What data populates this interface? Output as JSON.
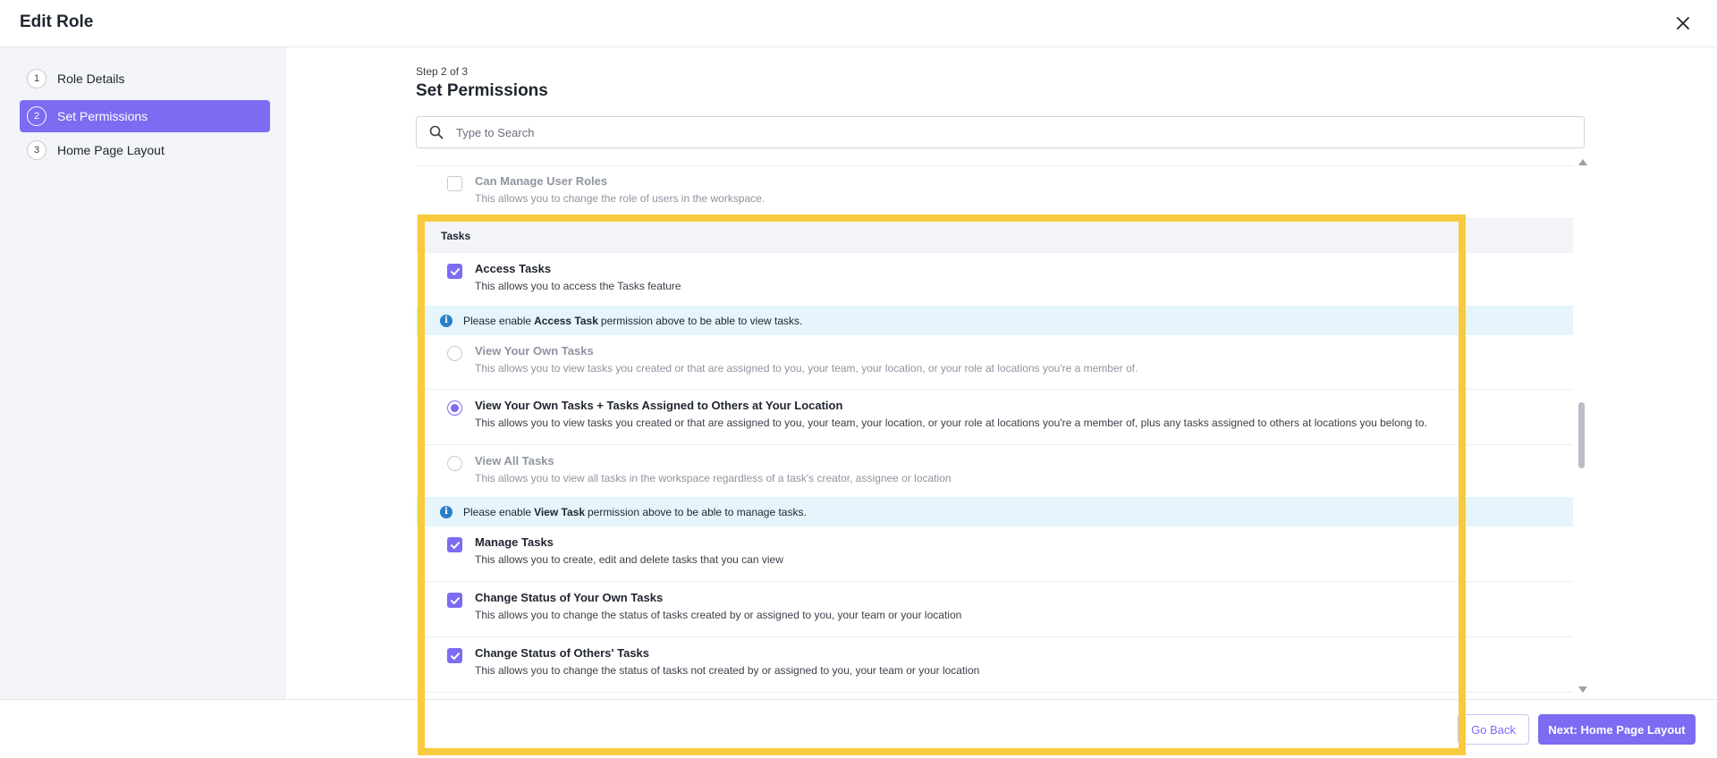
{
  "header": {
    "title": "Edit Role"
  },
  "sidebar": {
    "steps": [
      {
        "num": "1",
        "label": "Role Details"
      },
      {
        "num": "2",
        "label": "Set Permissions"
      },
      {
        "num": "3",
        "label": "Home Page Layout"
      }
    ],
    "active_step": "Set Permissions"
  },
  "main": {
    "step_label": "Step 2 of 3",
    "title": "Set Permissions",
    "search": {
      "placeholder": "Type to Search"
    },
    "permissions": {
      "manage_user_roles": {
        "title": "Can Manage User Roles",
        "desc": "This allows you to change the role of users in the workspace.",
        "checked": false
      },
      "tasks_group": "Tasks",
      "access_tasks": {
        "title": "Access Tasks",
        "desc": "This allows you to access the Tasks feature",
        "checked": true
      },
      "info_access": {
        "pre": "Please enable",
        "bold": "Access Task",
        "post": "permission above to be able to view tasks."
      },
      "view_own": {
        "title": "View Your Own Tasks",
        "desc": "This allows you to view tasks you created or that are assigned to you, your team, your location, or your role at locations you're a member of.",
        "selected": false
      },
      "view_own_location": {
        "title": "View Your Own Tasks + Tasks Assigned to Others at Your Location",
        "desc": "This allows you to view tasks you created or that are assigned to you, your team, your location, or your role at locations you're a member of, plus any tasks assigned to others at locations you belong to.",
        "selected": true
      },
      "view_all": {
        "title": "View All Tasks",
        "desc": "This allows you to view all tasks in the workspace regardless of a task's creator, assignee or location",
        "selected": false
      },
      "info_view": {
        "pre": "Please enable",
        "bold": "View Task",
        "post": "permission above to be able to manage tasks."
      },
      "manage_tasks": {
        "title": "Manage Tasks",
        "desc": "This allows you to create, edit and delete tasks that you can view",
        "checked": true
      },
      "change_own_status": {
        "title": "Change Status of Your Own Tasks",
        "desc": "This allows you to change the status of tasks created by or assigned to you, your team or your location",
        "checked": true
      },
      "change_others_status": {
        "title": "Change Status of Others' Tasks",
        "desc": "This allows you to change the status of tasks not created by or assigned to you, your team or your location",
        "checked": true
      }
    }
  },
  "footer": {
    "back_label": "Go Back",
    "next_label": "Next: Home Page Layout"
  },
  "colors": {
    "accent": "#7b6cf2",
    "highlight": "#f7cb3d",
    "info_bg": "#e6f4fb",
    "info_icon": "#2a7fc9",
    "sidebar_bg": "#f3f4f7"
  }
}
